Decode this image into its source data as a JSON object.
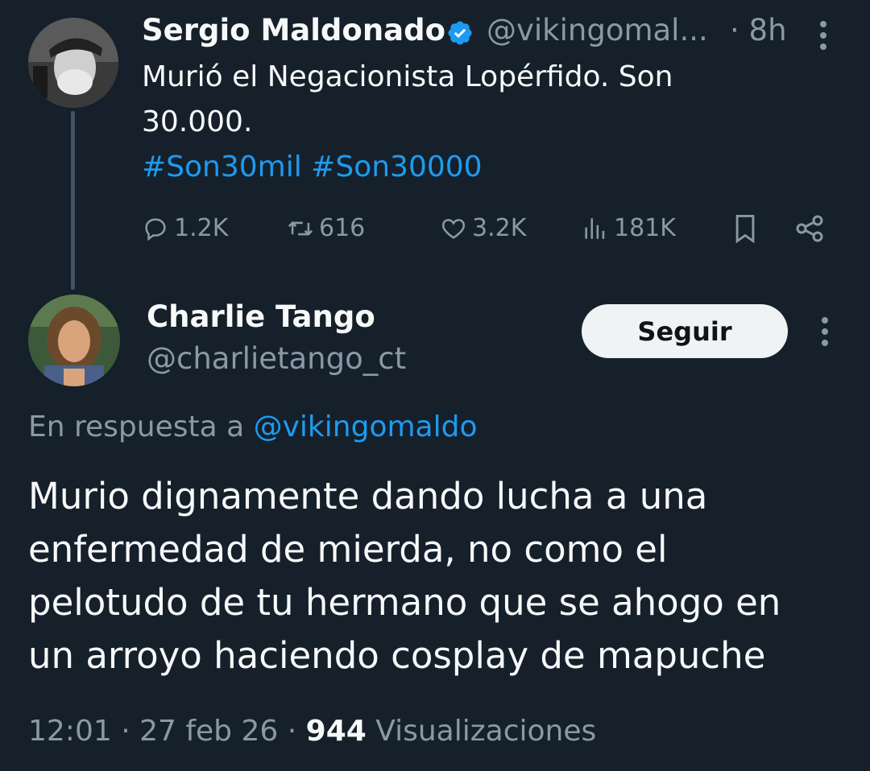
{
  "parent": {
    "name": "Sergio Maldonado",
    "handle": "@vikingomal...",
    "time": "· 8h",
    "text_line1": "Murió el Negacionista Lopérfido. Son",
    "text_line2": "30.000.",
    "hashtags": "#Son30mil #Son30000",
    "stats": {
      "replies": "1.2K",
      "retweets": "616",
      "likes": "3.2K",
      "views": "181K"
    }
  },
  "reply": {
    "name": "Charlie Tango",
    "handle": "@charlietango_ct",
    "follow_label": "Seguir",
    "reply_to_prefix": "En respuesta a",
    "reply_to_mention": "@vikingomaldo",
    "text_lines": [
      "Murio dignamente dando lucha a una",
      "enfermedad de mierda, no como el",
      "pelotudo de tu hermano que se ahogo en",
      "un arroyo haciendo cosplay de mapuche"
    ],
    "meta": {
      "time": "12:01",
      "date": "27 feb 26",
      "views_count": "944",
      "views_label": "Visualizaciones"
    }
  },
  "colors": {
    "background": "#15202b",
    "accent": "#1d9bf0",
    "secondary_text": "#8b98a5"
  }
}
